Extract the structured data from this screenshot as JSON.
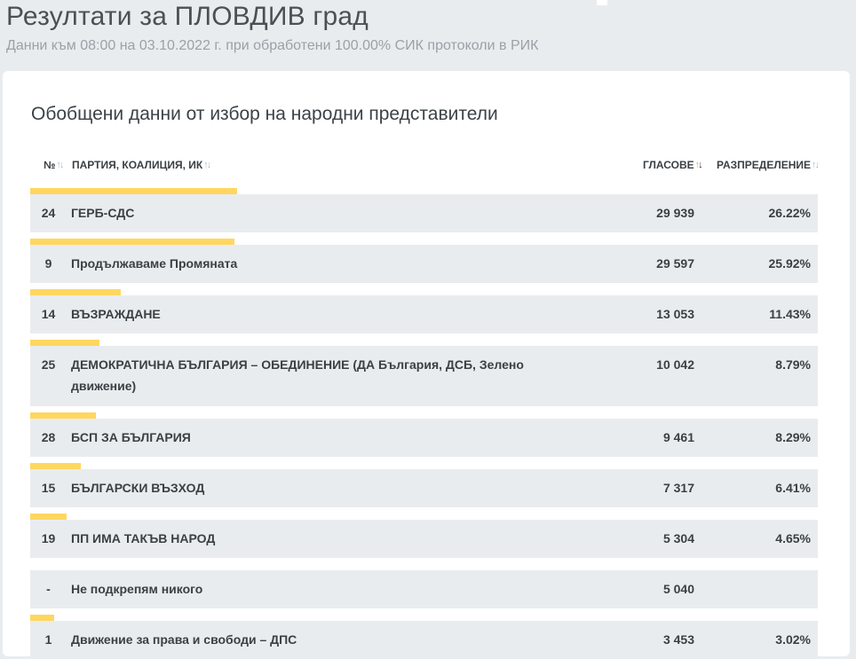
{
  "header": {
    "title": "Резултати за ПЛОВДИВ град",
    "subtitle": "Данни към 08:00 на 03.10.2022 г. при обработени 100.00% СИК протоколи в РИК"
  },
  "section": {
    "title": "Обобщени данни от избор на народни представители"
  },
  "table": {
    "columns": {
      "number": "№",
      "party": "ПАРТИЯ, КОАЛИЦИЯ, ИК",
      "votes": "ГЛАСОВЕ",
      "share": "РАЗПРЕДЕЛЕНИЕ"
    },
    "sorted_column": "votes",
    "sort_direction": "desc",
    "bar_color": "#ffd760",
    "row_color": "#e9ecef",
    "rows": [
      {
        "num": "24",
        "name": "ГЕРБ-СДС",
        "votes": "29 939",
        "share": "26.22%",
        "share_value": 26.22
      },
      {
        "num": "9",
        "name": "Продължаваме Промяната",
        "votes": "29 597",
        "share": "25.92%",
        "share_value": 25.92
      },
      {
        "num": "14",
        "name": "ВЪЗРАЖДАНЕ",
        "votes": "13 053",
        "share": "11.43%",
        "share_value": 11.43
      },
      {
        "num": "25",
        "name": "ДЕМОКРАТИЧНА БЪЛГАРИЯ – ОБЕДИНЕНИЕ (ДА България, ДСБ, Зелено движение)",
        "votes": "10 042",
        "share": "8.79%",
        "share_value": 8.79
      },
      {
        "num": "28",
        "name": "БСП ЗА БЪЛГАРИЯ",
        "votes": "9 461",
        "share": "8.29%",
        "share_value": 8.29
      },
      {
        "num": "15",
        "name": "БЪЛГАРСКИ ВЪЗХОД",
        "votes": "7 317",
        "share": "6.41%",
        "share_value": 6.41
      },
      {
        "num": "19",
        "name": "ПП ИМА ТАКЪВ НАРОД",
        "votes": "5 304",
        "share": "4.65%",
        "share_value": 4.65
      },
      {
        "num": "-",
        "name": "Не подкрепям никого",
        "votes": "5 040",
        "share": "",
        "share_value": 0
      },
      {
        "num": "1",
        "name": "Движение за права и свободи – ДПС",
        "votes": "3 453",
        "share": "3.02%",
        "share_value": 3.02
      }
    ]
  }
}
